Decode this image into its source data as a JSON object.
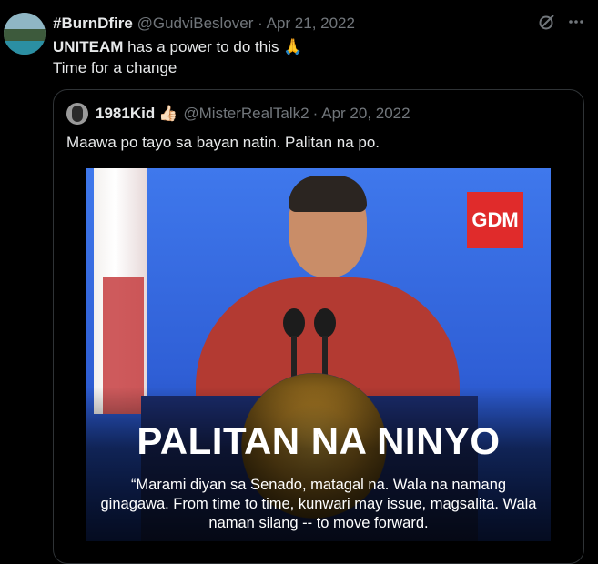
{
  "tweet": {
    "author_name": "#BurnDfire",
    "handle": "@GudviBeslover",
    "dot": "·",
    "date": "Apr 21, 2022",
    "text_bold": "UNITEAM",
    "text_line1_rest": " has a power to do this 🙏",
    "text_line2": "Time for a change"
  },
  "header_icons": [
    "grok-icon",
    "more-icon"
  ],
  "quote": {
    "author_name": "1981Kid",
    "emoji": "👍🏻",
    "handle": "@MisterRealTalk2",
    "dot": "·",
    "date": "Apr 20, 2022",
    "text": "Maawa po tayo sa bayan natin. Palitan na po."
  },
  "media": {
    "logo_text": "GDM",
    "headline": "PALITAN NA NINYO",
    "caption": "“Marami diyan sa Senado, matagal na. Wala na namang ginagawa. From time to time, kunwari may issue, magsalita. Wala naman silang -- to move forward."
  },
  "colors": {
    "background": "#000000",
    "text": "#e7e9ea",
    "muted": "#71767b",
    "border": "#2f3336",
    "logo_red": "#e02b2b"
  }
}
